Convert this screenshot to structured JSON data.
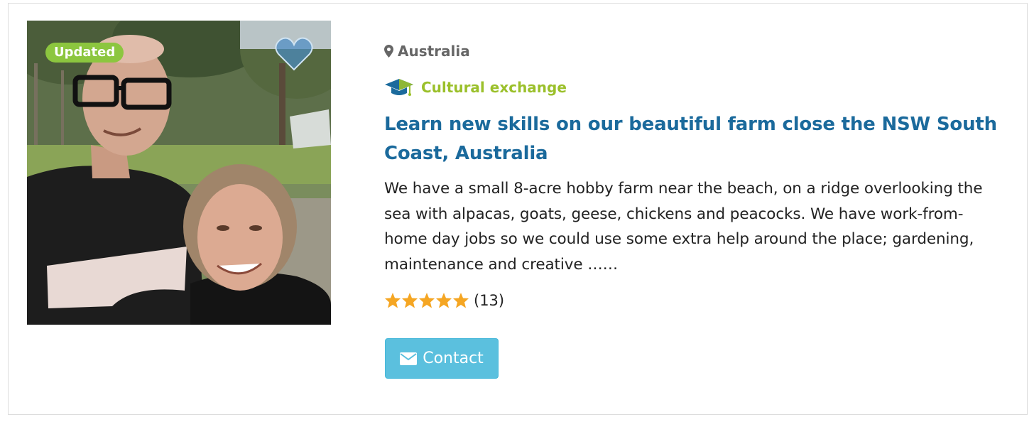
{
  "listing": {
    "badge": "Updated",
    "location": "Australia",
    "category": "Cultural exchange",
    "title": "Learn new skills on our beautiful farm close the NSW South Coast, Australia",
    "description": "We have a small 8-acre hobby farm near the beach, on a ridge overlooking the sea with alpacas, goats, geese, chickens and peacocks. We have work-from-home day jobs so we could use some extra help around the place; gardening, maintenance and creative ……",
    "rating_stars": 5,
    "rating_count": "(13)",
    "contact_label": "Contact"
  },
  "icons": {
    "location": "map-marker-icon",
    "category": "graduation-cap-icon",
    "favorite": "heart-icon",
    "contact": "envelope-icon",
    "star": "star-icon"
  },
  "colors": {
    "badge": "#8cc63f",
    "category": "#9bc02b",
    "title": "#1b6a9c",
    "contact_button": "#5bc0de",
    "star": "#f5a623",
    "location": "#666666"
  }
}
